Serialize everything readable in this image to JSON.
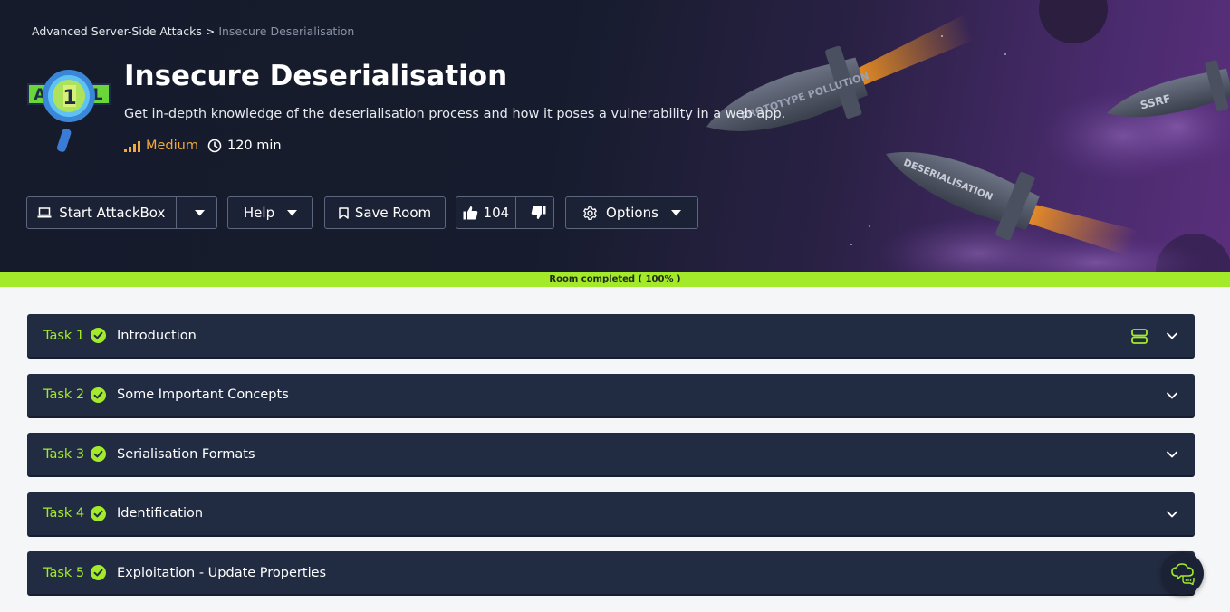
{
  "breadcrumb": {
    "parent": "Advanced Server-Side Attacks",
    "separator": ">",
    "current": "Insecure Deserialisation"
  },
  "room": {
    "title": "Insecure Deserialisation",
    "description": "Get in-depth knowledge of the deserialisation process and how it poses a vulnerability in a web app.",
    "difficulty": "Medium",
    "duration": "120 min",
    "logo_letters": [
      "A",
      "1",
      "L"
    ]
  },
  "art_labels": {
    "rocket_1": "PROTOTYPE POLLUTION",
    "rocket_2": "SSRF",
    "rocket_3": "DESERIALISATION"
  },
  "toolbar": {
    "start_attackbox": "Start AttackBox",
    "help": "Help",
    "save_room": "Save Room",
    "like_count": "104",
    "options": "Options"
  },
  "progress": {
    "label": "Room completed ( 100% )",
    "percent": 100
  },
  "tasks": [
    {
      "number": "Task 1",
      "title": "Introduction",
      "completed": true
    },
    {
      "number": "Task 2",
      "title": "Some Important Concepts",
      "completed": true
    },
    {
      "number": "Task 3",
      "title": "Serialisation Formats",
      "completed": true
    },
    {
      "number": "Task 4",
      "title": "Identification",
      "completed": true
    },
    {
      "number": "Task 5",
      "title": "Exploitation - Update Properties",
      "completed": true
    }
  ],
  "icons": {
    "difficulty": "signal-bars-icon",
    "duration": "clock-icon",
    "attackbox": "laptop-icon",
    "save": "bookmark-icon",
    "like": "thumbs-up-icon",
    "dislike": "thumbs-down-icon",
    "options": "gear-icon",
    "task_status": "check-circle-icon",
    "expand": "chevron-down-icon",
    "chat": "chat-bubble-icon"
  },
  "colors": {
    "accent_green": "#a3ea2a",
    "difficulty_orange": "#f2a93b",
    "task_bg": "#212c42",
    "hero_dark": "#151b2b",
    "hero_purple": "#5a2f7c"
  }
}
